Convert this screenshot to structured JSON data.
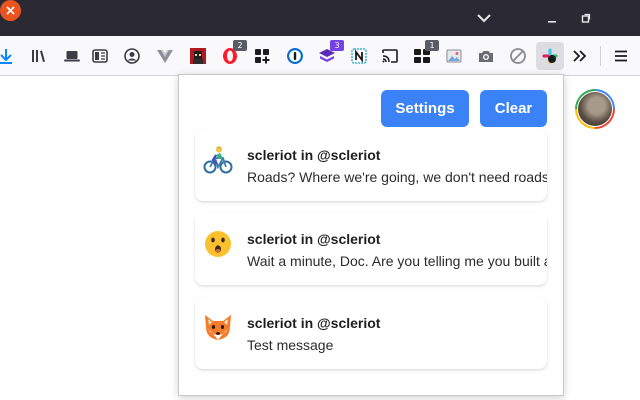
{
  "window": {
    "controls": [
      "chevron-down-icon",
      "minimize-icon",
      "maximize-icon",
      "close-icon"
    ],
    "close_color": "#e95420"
  },
  "toolbar": {
    "icons": [
      "download-icon",
      "library-icon",
      "laptop-icon",
      "reader-view-icon",
      "account-icon",
      "vue-devtools-icon",
      "pixel-avatar-extension-icon",
      "opera-extension-icon",
      "grid-apps-extension-icon",
      "password-manager-icon",
      "stack-extension-icon",
      "notion-extension-icon",
      "cast-icon",
      "dashboard-extension-icon",
      "image-extension-icon",
      "camera-extension-icon",
      "block-icon",
      "slack-notifier-extension-icon",
      "overflow-chevrons-icon",
      "menu-icon"
    ],
    "badges": {
      "opera": "2",
      "stack": "3",
      "dashboard": "1"
    }
  },
  "popup": {
    "settings_label": "Settings",
    "clear_label": "Clear",
    "accent_color": "#3b82f6",
    "notifications": [
      {
        "icon": "bicyclist-emoji-icon",
        "title": "scleriot in @scleriot",
        "message": "Roads? Where we're going, we don't need roads"
      },
      {
        "icon": "surprised-face-emoji-icon",
        "title": "scleriot in @scleriot",
        "message": "Wait a minute, Doc. Are you telling me you built a time machine"
      },
      {
        "icon": "fox-emoji-icon",
        "title": "scleriot in @scleriot",
        "message": "Test message"
      }
    ]
  }
}
